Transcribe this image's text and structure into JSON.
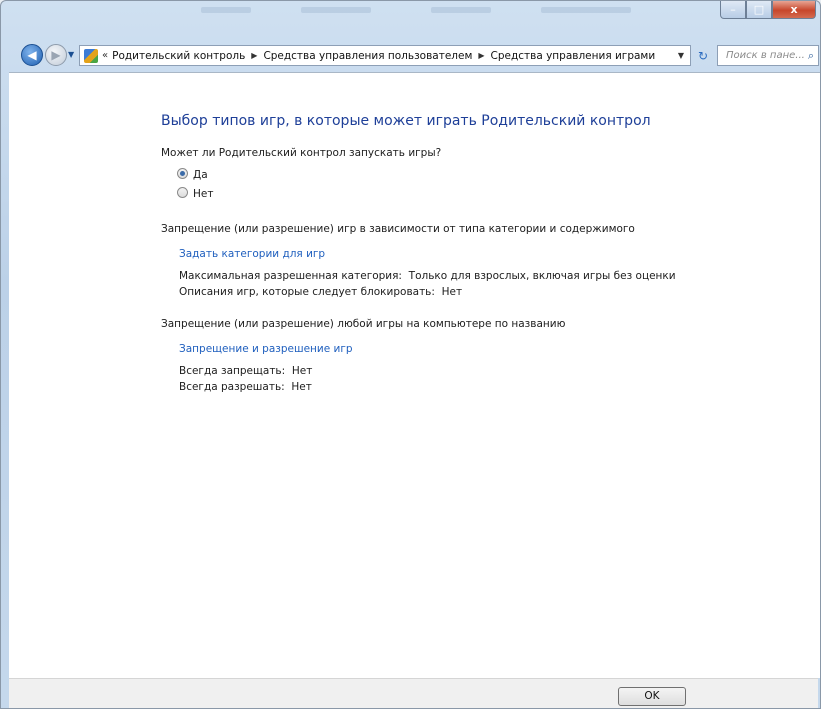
{
  "window": {
    "caption_buttons": {
      "minimize": "–",
      "maximize": "□",
      "close": "x"
    }
  },
  "navbar": {
    "back_glyph": "◀",
    "forward_glyph": "▶",
    "history_glyph": "▼",
    "breadcrumb_prefix": "«",
    "breadcrumb": [
      "Родительский контроль",
      "Средства управления пользователем",
      "Средства управления играми"
    ],
    "separator_glyph": "▶",
    "dropdown_glyph": "▼",
    "refresh_glyph": "↻",
    "search_placeholder": "Поиск в пане...",
    "search_icon": "search-icon"
  },
  "main": {
    "heading": "Выбор типов игр, в которые может играть Родительский контрол",
    "question": "Может ли Родительский контрол запускать игры?",
    "radio_yes": "Да",
    "radio_no": "Нет",
    "selected": "yes",
    "section1_title": "Запрещение (или разрешение) игр в зависимости от типа категории и содержимого",
    "section1_link": "Задать категории для игр",
    "max_category_label": "Максимальная разрешенная категория:",
    "max_category_value": "Только для взрослых, включая игры без оценки",
    "block_desc_label": "Описания игр, которые следует блокировать:",
    "block_desc_value": "Нет",
    "section2_title": "Запрещение (или разрешение) любой игры на компьютере по названию",
    "section2_link": "Запрещение и разрешение игр",
    "always_block_label": "Всегда запрещать:",
    "always_block_value": "Нет",
    "always_allow_label": "Всегда разрешать:",
    "always_allow_value": "Нет"
  },
  "footer": {
    "ok_label": "OK"
  },
  "colors": {
    "link": "#1f5fbe",
    "heading": "#1e3f98",
    "close_button": "#c7462b"
  }
}
